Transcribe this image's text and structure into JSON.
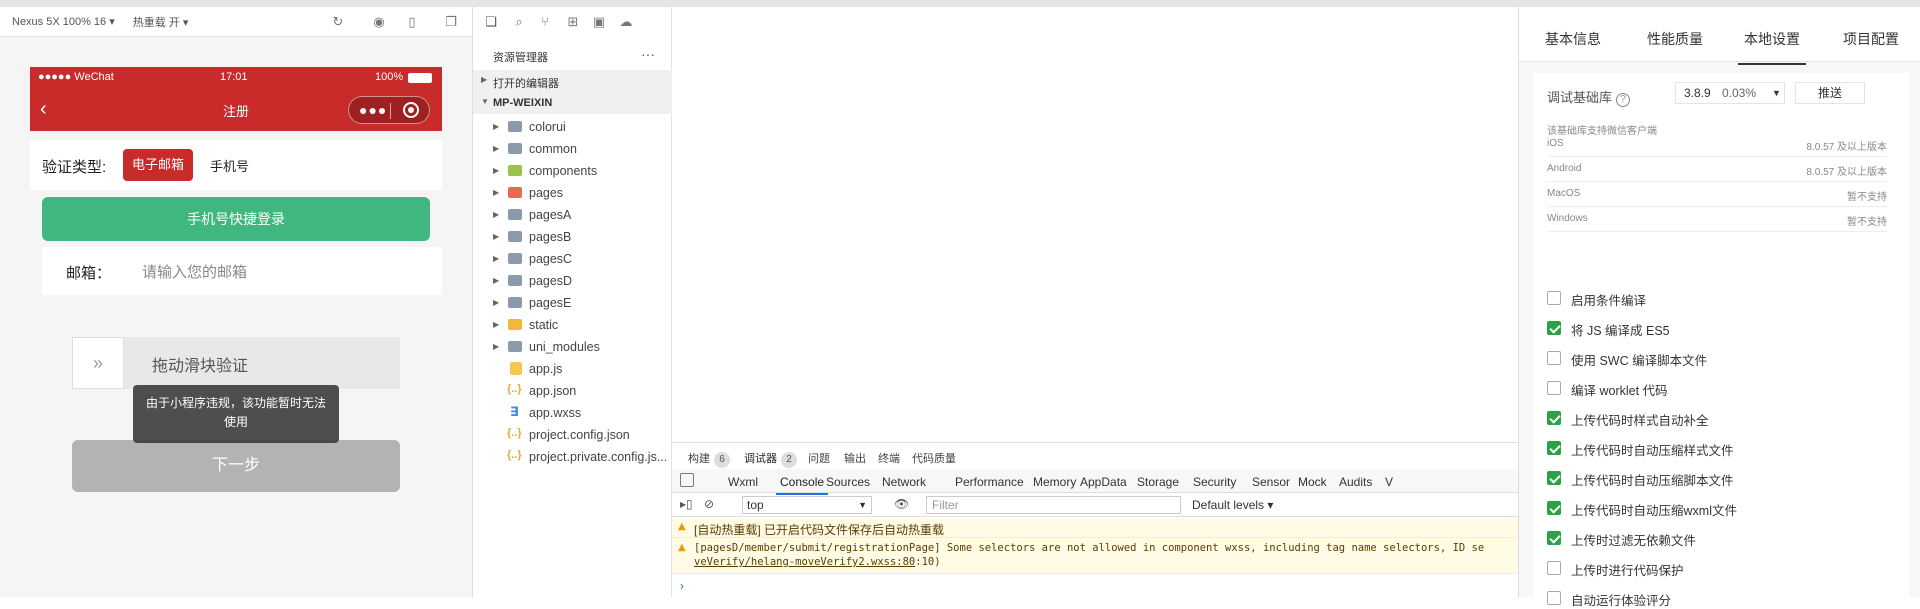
{
  "simulator_toolbar": {
    "device": "Nexus 5X 100% 16 ▾",
    "hot_reload": "热重载 开 ▾"
  },
  "phone": {
    "status_left": "●●●●● WeChat",
    "status_time": "17:01",
    "status_battery": "100%",
    "nav_title": "注册",
    "verify_label": "验证类型:",
    "verify_email": "电子邮箱",
    "verify_phone": "手机号",
    "quick_login": "手机号快捷登录",
    "email_label": "邮箱：",
    "email_placeholder": "请输入您的邮箱",
    "slider_handle": "»",
    "slider_text": "拖动滑块验证",
    "toast": "由于小程序违规，该功能暂时无法使用",
    "next": "下一步"
  },
  "explorer": {
    "title": "资源管理器",
    "more": "···",
    "open_editors": "打开的编辑器",
    "project": "MP-WEIXIN",
    "items": [
      {
        "name": "colorui",
        "type": "folder"
      },
      {
        "name": "common",
        "type": "folder"
      },
      {
        "name": "components",
        "type": "folder"
      },
      {
        "name": "pages",
        "type": "folder"
      },
      {
        "name": "pagesA",
        "type": "folder"
      },
      {
        "name": "pagesB",
        "type": "folder"
      },
      {
        "name": "pagesC",
        "type": "folder"
      },
      {
        "name": "pagesD",
        "type": "folder"
      },
      {
        "name": "pagesE",
        "type": "folder"
      },
      {
        "name": "static",
        "type": "folder"
      },
      {
        "name": "uni_modules",
        "type": "folder"
      },
      {
        "name": "app.js",
        "type": "js"
      },
      {
        "name": "app.json",
        "type": "json"
      },
      {
        "name": "app.wxss",
        "type": "wxss"
      },
      {
        "name": "project.config.json",
        "type": "json"
      },
      {
        "name": "project.private.config.js...",
        "type": "json"
      }
    ]
  },
  "devtools": {
    "tabs1": [
      {
        "label": "构建",
        "badge": "6"
      },
      {
        "label": "调试器",
        "badge": "2"
      },
      {
        "label": "问题",
        "badge": ""
      },
      {
        "label": "输出",
        "badge": ""
      },
      {
        "label": "终端",
        "badge": ""
      },
      {
        "label": "代码质量",
        "badge": ""
      }
    ],
    "tabs2": [
      "Wxml",
      "Console",
      "Sources",
      "Network",
      "Performance",
      "Memory",
      "AppData",
      "Storage",
      "Security",
      "Sensor",
      "Mock",
      "Audits",
      "V"
    ],
    "context": "top",
    "filter_placeholder": "Filter",
    "levels": "Default levels ▾",
    "msg1": "[自动热重载] 已开启代码文件保存后自动热重载",
    "msg2_line1": "[pagesD/member/submit/registrationPage] Some selectors are not allowed in component wxss, including tag name selectors, ID se",
    "msg2_link": "veVerify/helang-moveVerify2.wxss:80",
    "msg2_tail": ":10)",
    "prompt": "›"
  },
  "settings": {
    "tabs": [
      "基本信息",
      "性能质量",
      "本地设置",
      "项目配置"
    ],
    "active_tab": "本地设置",
    "lib_label": "调试基础库",
    "lib_version": "3.8.9",
    "lib_percent": "0.03%",
    "push": "推送",
    "support_title": "该基础库支持微信客户端",
    "support": [
      {
        "os": "iOS",
        "value": "8.0.57 及以上版本"
      },
      {
        "os": "Android",
        "value": "8.0.57 及以上版本"
      },
      {
        "os": "MacOS",
        "value": "暂不支持"
      },
      {
        "os": "Windows",
        "value": "暂不支持"
      }
    ],
    "options": [
      {
        "label": "启用条件编译",
        "checked": false
      },
      {
        "label": "将 JS 编译成 ES5",
        "checked": true
      },
      {
        "label": "使用 SWC 编译脚本文件",
        "checked": false
      },
      {
        "label": "编译 worklet 代码",
        "checked": false
      },
      {
        "label": "上传代码时样式自动补全",
        "checked": true
      },
      {
        "label": "上传代码时自动压缩样式文件",
        "checked": true
      },
      {
        "label": "上传代码时自动压缩脚本文件",
        "checked": true
      },
      {
        "label": "上传代码时自动压缩wxml文件",
        "checked": true
      },
      {
        "label": "上传时过滤无依赖文件",
        "checked": true
      },
      {
        "label": "上传时进行代码保护",
        "checked": false
      },
      {
        "label": "自动运行体验评分",
        "checked": false
      }
    ]
  },
  "colors": {
    "brand_red": "#c92a2a",
    "green": "#3fb77e",
    "check_green": "#2ba245"
  }
}
